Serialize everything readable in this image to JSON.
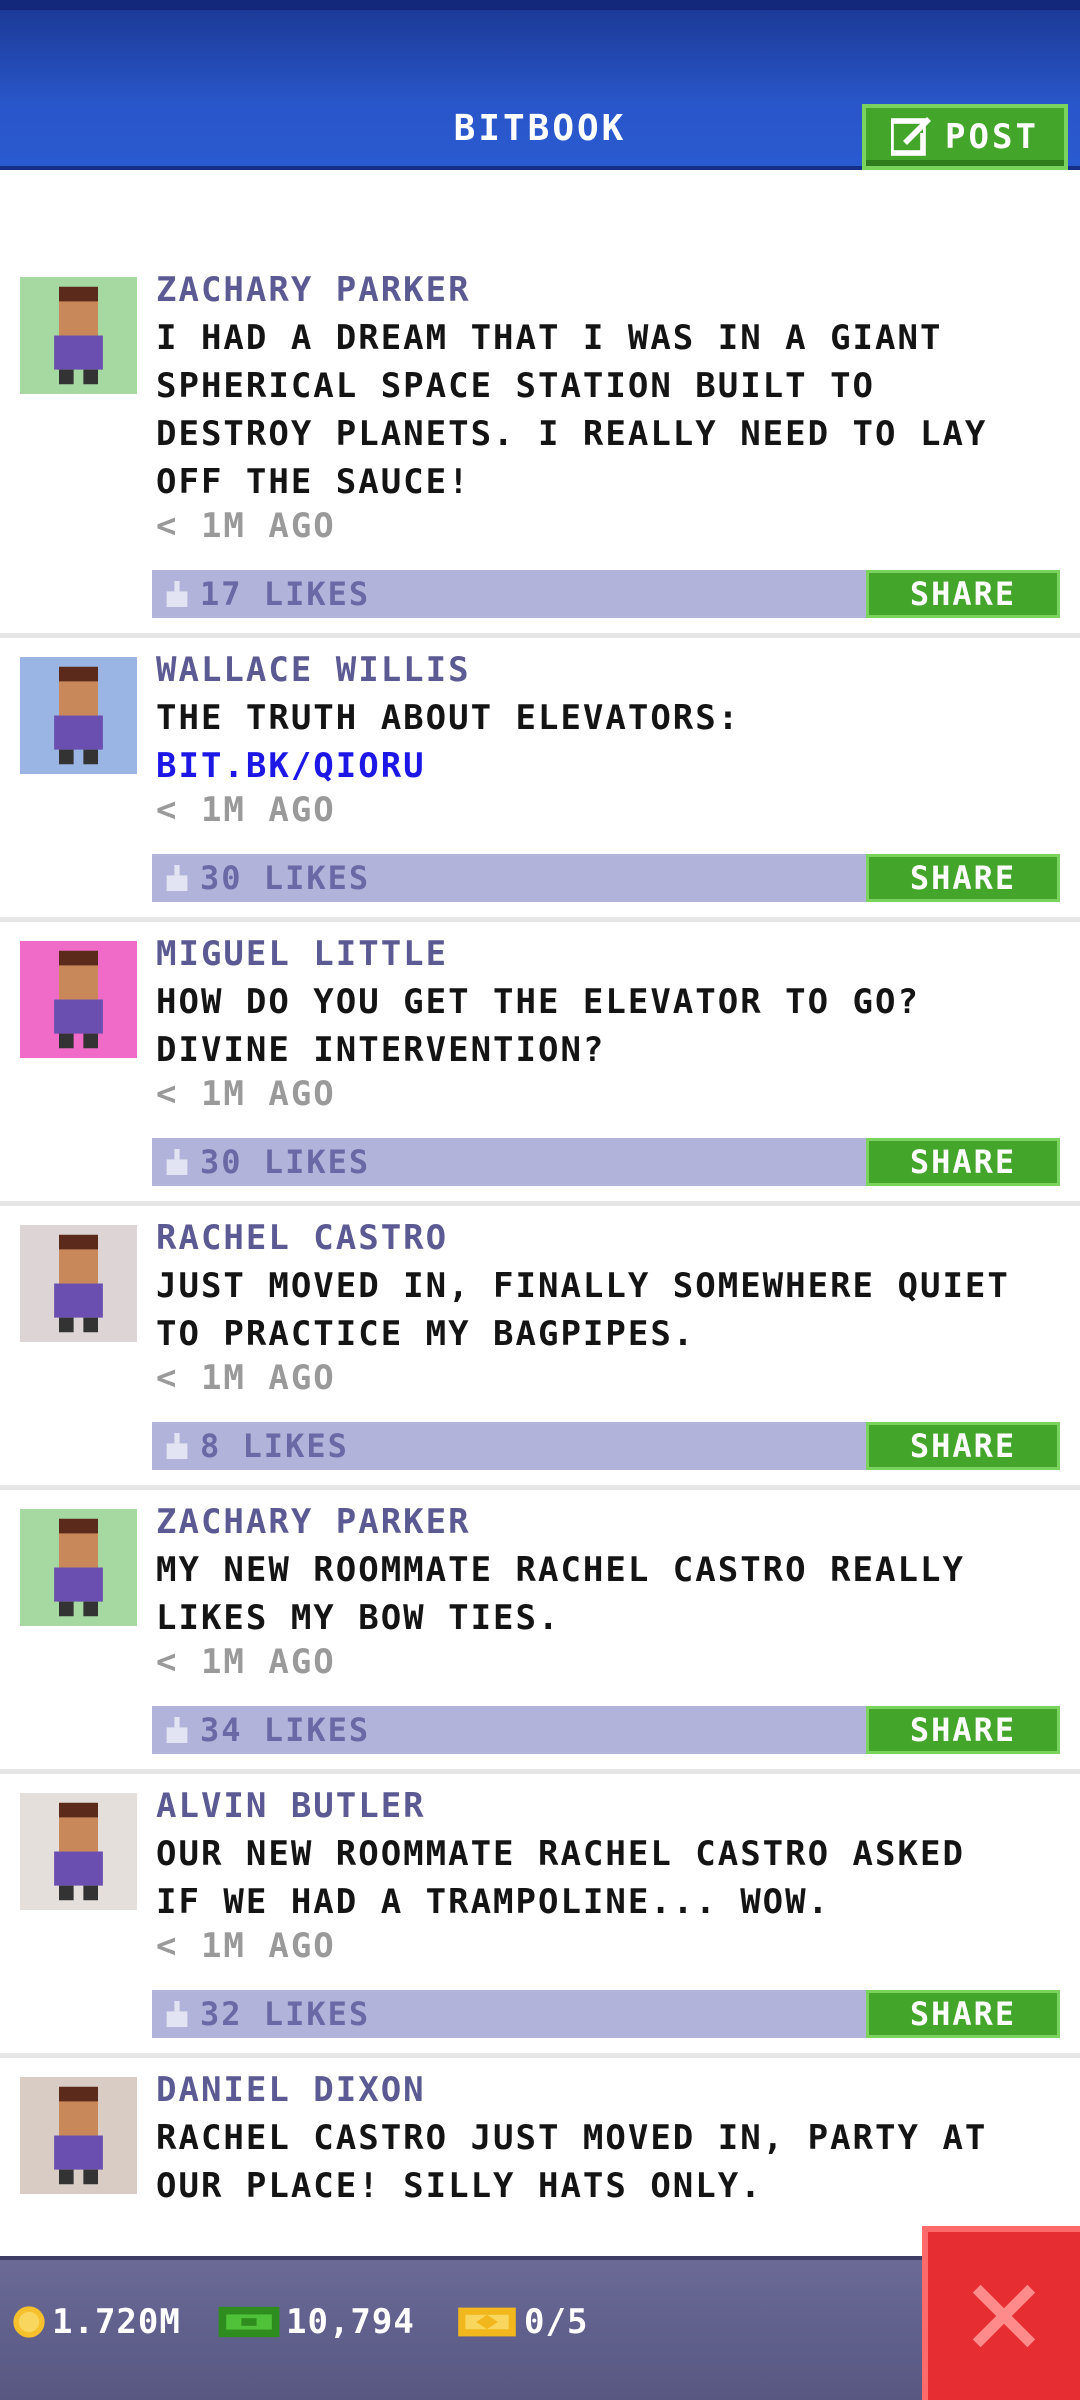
{
  "header": {
    "title": "BITBOOK",
    "post_label": "POST"
  },
  "posts": [
    {
      "author": "ZACHARY PARKER",
      "lines": [
        "I HAD A DREAM THAT I WAS IN A GIANT",
        "SPHERICAL SPACE STATION BUILT TO",
        "DESTROY PLANETS. I REALLY NEED TO LAY",
        "OFF THE SAUCE!"
      ],
      "link": "",
      "time": "< 1M AGO",
      "likes": "17 LIKES",
      "share_label": "SHARE",
      "avatar_bg": "#a6d9a2"
    },
    {
      "author": "WALLACE WILLIS",
      "lines": [
        "THE TRUTH ABOUT ELEVATORS:"
      ],
      "link": "BIT.BK/QIORU",
      "time": "< 1M AGO",
      "likes": "30 LIKES",
      "share_label": "SHARE",
      "avatar_bg": "#9ab5e4"
    },
    {
      "author": "MIGUEL LITTLE",
      "lines": [
        "HOW DO YOU GET THE ELEVATOR TO GO?",
        "DIVINE INTERVENTION?"
      ],
      "link": "",
      "time": "< 1M AGO",
      "likes": "30 LIKES",
      "share_label": "SHARE",
      "avatar_bg": "#f06ac8"
    },
    {
      "author": "RACHEL CASTRO",
      "lines": [
        "JUST MOVED IN, FINALLY SOMEWHERE QUIET",
        "TO PRACTICE MY BAGPIPES."
      ],
      "link": "",
      "time": "< 1M AGO",
      "likes": "8 LIKES",
      "share_label": "SHARE",
      "avatar_bg": "#ddd5d5"
    },
    {
      "author": "ZACHARY PARKER",
      "lines": [
        "MY NEW ROOMMATE RACHEL CASTRO REALLY",
        "LIKES MY BOW TIES."
      ],
      "link": "",
      "time": "< 1M AGO",
      "likes": "34 LIKES",
      "share_label": "SHARE",
      "avatar_bg": "#a6d9a2"
    },
    {
      "author": "ALVIN BUTLER",
      "lines": [
        "OUR NEW ROOMMATE RACHEL CASTRO ASKED",
        "IF WE HAD A TRAMPOLINE... WOW."
      ],
      "link": "",
      "time": "< 1M AGO",
      "likes": "32 LIKES",
      "share_label": "SHARE",
      "avatar_bg": "#e5dfdc"
    },
    {
      "author": "DANIEL DIXON",
      "lines": [
        "RACHEL CASTRO JUST MOVED IN, PARTY AT",
        "OUR PLACE! SILLY HATS ONLY."
      ],
      "link": "",
      "time": "",
      "likes": "",
      "share_label": "",
      "avatar_bg": "#d8ccc4"
    }
  ],
  "footer": {
    "coins": "1.720M",
    "bux": "10,794",
    "tickets": "0/5"
  },
  "colors": {
    "accent_green": "#43a52a",
    "close_red": "#e62e32",
    "header_blue": "#2956c9"
  }
}
